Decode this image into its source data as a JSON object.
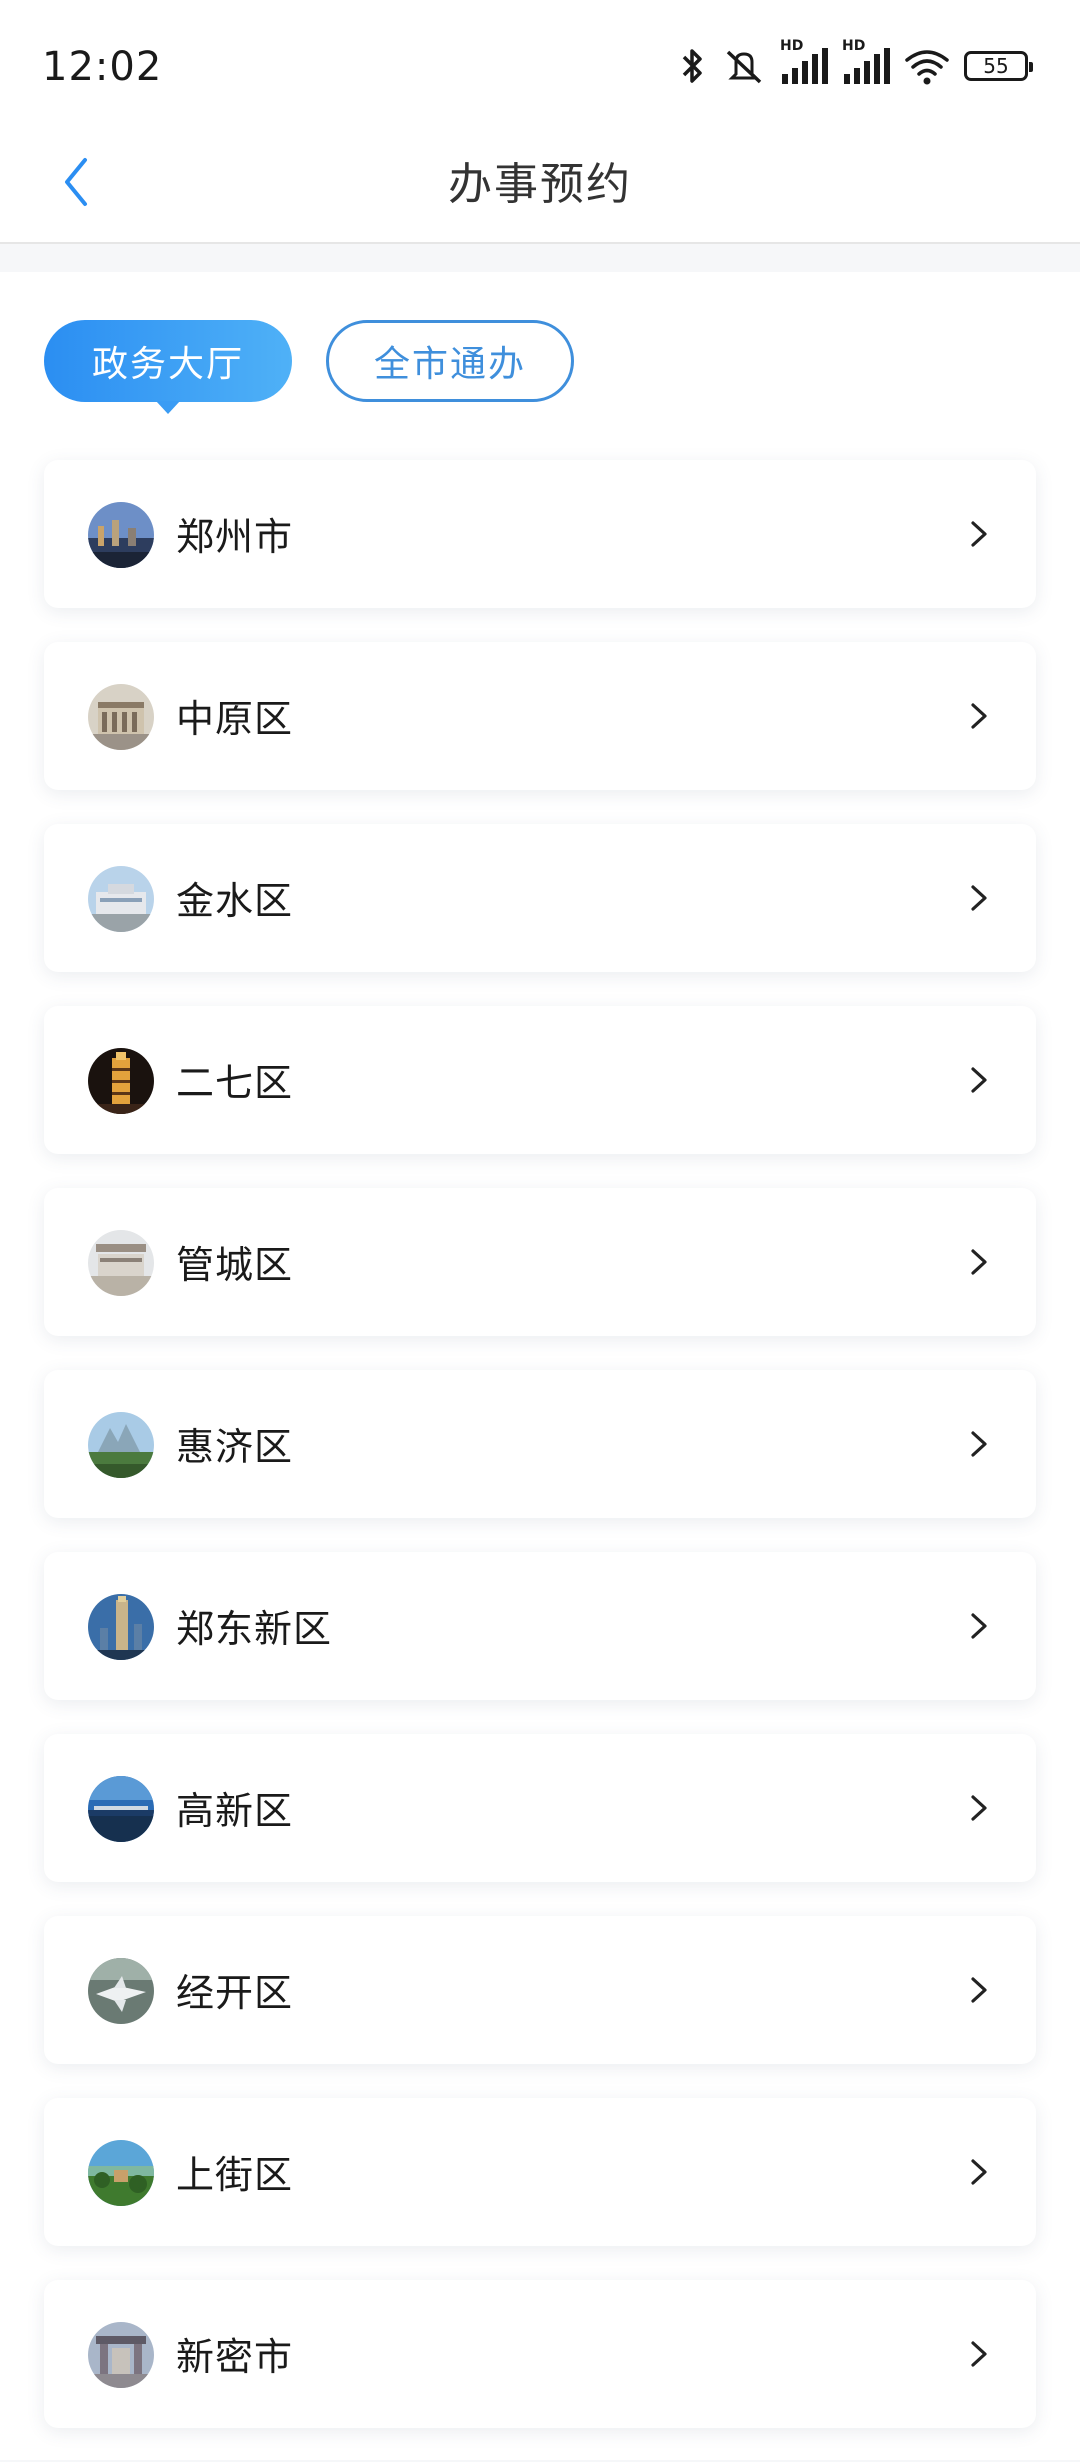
{
  "status_bar": {
    "time": "12:02",
    "icons": [
      "bluetooth-icon",
      "silent-icon",
      "signal-hd-icon",
      "signal-hd-icon",
      "wifi-icon",
      "battery-icon"
    ],
    "signal_label_1": "HD",
    "signal_label_2": "HD",
    "battery": "55"
  },
  "nav": {
    "title": "办事预约",
    "back_icon": "chevron-left-icon"
  },
  "tabs": [
    {
      "label": "政务大厅",
      "active": true
    },
    {
      "label": "全市通办",
      "active": false
    }
  ],
  "colors": {
    "accent": "#2b8ef2",
    "accent_light": "#4fb1f7",
    "tab_outline": "#3f8fdc"
  },
  "regions": [
    {
      "label": "郑州市"
    },
    {
      "label": "中原区"
    },
    {
      "label": "金水区"
    },
    {
      "label": "二七区"
    },
    {
      "label": "管城区"
    },
    {
      "label": "惠济区"
    },
    {
      "label": "郑东新区"
    },
    {
      "label": "高新区"
    },
    {
      "label": "经开区"
    },
    {
      "label": "上街区"
    },
    {
      "label": "新密市"
    }
  ]
}
